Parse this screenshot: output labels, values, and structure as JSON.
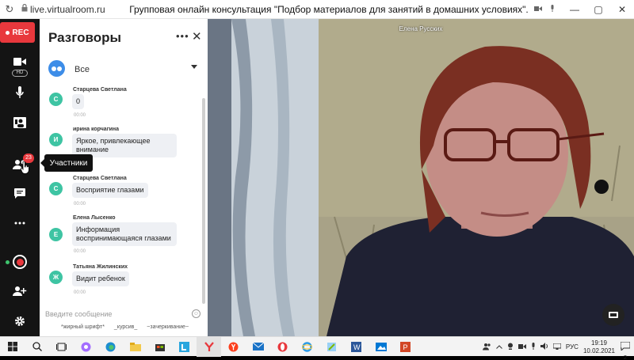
{
  "browser": {
    "url": "live.virtualroom.ru",
    "page_title": "Групповая онлайн консультация \"Подбор материалов для занятий в домашних условиях\".",
    "reload_icon": "↻",
    "lock_icon": "🔒",
    "min_icon": "—",
    "max_icon": "▢",
    "close_icon": "✕"
  },
  "toolbar": {
    "rec_label": "REC",
    "hd_label": "HD",
    "participants_count": "23",
    "participants_tooltip": "Участники",
    "accent_color": "#e8383d"
  },
  "chat": {
    "title": "Разговоры",
    "more_icon": "•••",
    "close_icon": "✕",
    "filter_label": "Все",
    "messages": [
      {
        "initial": "С",
        "author": "Старцева Светлана",
        "text": "0",
        "time": "00:00",
        "color": "#3ec4a3"
      },
      {
        "initial": "И",
        "author": "ирина корчагина",
        "text": "Яркое, привлекающее внимание",
        "time": "00:00",
        "color": "#3ec4a3"
      },
      {
        "initial": "С",
        "author": "Старцева Светлана",
        "text": "Восприятие глазами",
        "time": "00:00",
        "color": "#3ec4a3"
      },
      {
        "initial": "Е",
        "author": "Елена Лысенко",
        "text": "Информация воспринимающаяся глазами",
        "time": "00:00",
        "color": "#3ec4a3"
      },
      {
        "initial": "Ж",
        "author": "Татьяна Жилинских",
        "text": "Видит ребенок",
        "time": "00:00",
        "color": "#3ec4a3"
      }
    ],
    "compose_placeholder": "Введите сообщение",
    "hints": [
      "*жирный шрифт*",
      "_курсив_",
      "~зачеркивание~"
    ]
  },
  "video": {
    "speaker_name": "Елена Русских"
  },
  "taskbar": {
    "language": "РУС",
    "time": "19:19",
    "date": "10.02.2021",
    "notifications": "2"
  }
}
